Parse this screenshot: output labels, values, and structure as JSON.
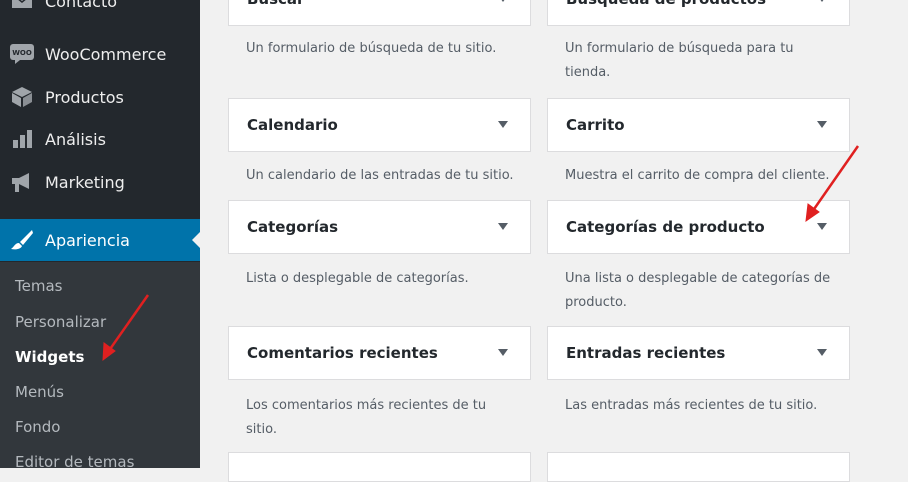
{
  "sidebar": {
    "menu": [
      {
        "label": "Contacto",
        "icon": "envelope-icon"
      },
      {
        "label": "WooCommerce",
        "icon": "woocommerce-icon",
        "badge": "WOO"
      },
      {
        "label": "Productos",
        "icon": "box-icon"
      },
      {
        "label": "Análisis",
        "icon": "bar-chart-icon"
      },
      {
        "label": "Marketing",
        "icon": "megaphone-icon"
      },
      {
        "label": "Apariencia",
        "icon": "paintbrush-icon",
        "active": true
      }
    ],
    "submenu": [
      {
        "label": "Temas"
      },
      {
        "label": "Personalizar"
      },
      {
        "label": "Widgets",
        "current": true
      },
      {
        "label": "Menús"
      },
      {
        "label": "Fondo"
      },
      {
        "label": "Editor de temas"
      }
    ]
  },
  "widgets": [
    {
      "title": "Buscar",
      "description": "Un formulario de búsqueda de tu sitio."
    },
    {
      "title": "Búsqueda de productos",
      "description": "Un formulario de búsqueda para tu tienda."
    },
    {
      "title": "Calendario",
      "description": "Un calendario de las entradas de tu sitio."
    },
    {
      "title": "Carrito",
      "description": "Muestra el carrito de compra del cliente."
    },
    {
      "title": "Categorías",
      "description": "Lista o desplegable de categorías."
    },
    {
      "title": "Categorías de producto",
      "description": "Una lista o desplegable de categorías de producto."
    },
    {
      "title": "Comentarios recientes",
      "description": "Los comentarios más recientes de tu sitio."
    },
    {
      "title": "Entradas recientes",
      "description": "Las entradas más recientes de tu sitio."
    }
  ],
  "colors": {
    "sidebar_bg": "#23282d",
    "submenu_bg": "#32373c",
    "active": "#0073aa",
    "annotation_arrow": "#e02020"
  }
}
